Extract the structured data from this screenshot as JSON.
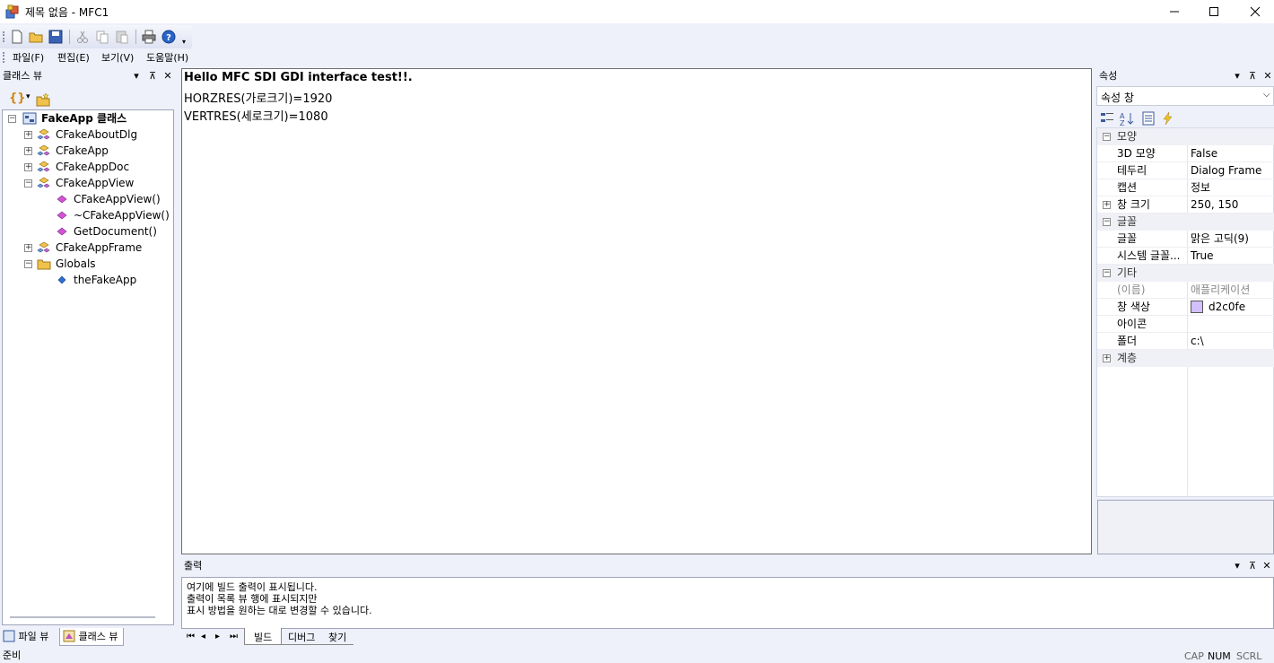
{
  "window": {
    "title": "제목 없음 - MFC1"
  },
  "menu": [
    "파일(F)",
    "편집(E)",
    "보기(V)",
    "도움말(H)"
  ],
  "classview": {
    "header": "클래스 뷰",
    "root": "FakeApp 클래스",
    "items": [
      {
        "label": "CFakeAboutDlg",
        "icon": "class-icon"
      },
      {
        "label": "CFakeApp",
        "icon": "class-icon"
      },
      {
        "label": "CFakeAppDoc",
        "icon": "class-icon"
      },
      {
        "label": "CFakeAppView",
        "icon": "class-icon"
      },
      {
        "label": "CFakeAppView()",
        "icon": "method-icon"
      },
      {
        "label": "~CFakeAppView()",
        "icon": "method-icon"
      },
      {
        "label": "GetDocument()",
        "icon": "method-icon"
      },
      {
        "label": "CFakeAppFrame",
        "icon": "class-icon"
      },
      {
        "label": "Globals",
        "icon": "folder-icon"
      },
      {
        "label": "theFakeApp",
        "icon": "variable-icon"
      }
    ],
    "tabs": [
      "파일 뷰",
      "클래스 뷰"
    ]
  },
  "document": {
    "lines": [
      "Hello MFC SDI GDI interface test!!.",
      "HORZRES(가로크기)=1920",
      "VERTRES(세로크기)=1080"
    ]
  },
  "properties": {
    "header": "속성",
    "combo": "속성 창",
    "rows": [
      {
        "type": "cat",
        "name": "모양",
        "exp": "⊟"
      },
      {
        "type": "prop",
        "name": "3D 모양",
        "value": "False"
      },
      {
        "type": "prop",
        "name": "테두리",
        "value": "Dialog Frame"
      },
      {
        "type": "prop",
        "name": "캡션",
        "value": "정보"
      },
      {
        "type": "prop",
        "name": "창 크기",
        "value": "250, 150",
        "exp": "⊞"
      },
      {
        "type": "cat",
        "name": "글꼴",
        "exp": "⊟"
      },
      {
        "type": "prop",
        "name": "글꼴",
        "value": "맑은 고딕(9)"
      },
      {
        "type": "prop",
        "name": "시스템 글꼴...",
        "value": "True"
      },
      {
        "type": "cat",
        "name": "기타",
        "exp": "⊟"
      },
      {
        "type": "prop",
        "name": "(이름)",
        "value": "애플리케이션",
        "disabled": true
      },
      {
        "type": "prop",
        "name": "창 색상",
        "value": "d2c0fe",
        "swatch": "#d2c0fe"
      },
      {
        "type": "prop",
        "name": "아이콘",
        "value": ""
      },
      {
        "type": "prop",
        "name": "폴더",
        "value": "c:\\"
      },
      {
        "type": "cat",
        "name": "계층",
        "exp": "⊞"
      }
    ]
  },
  "output": {
    "header": "출력",
    "lines": [
      "여기에 빌드 출력이 표시됩니다.",
      "출력이 목록 뷰 행에 표시되지만",
      "표시 방법을 원하는 대로 변경할 수 있습니다."
    ],
    "tabs": [
      "빌드",
      "디버그",
      "찾기"
    ]
  },
  "status": {
    "text": "준비",
    "indicators": [
      "CAP",
      "NUM",
      "SCRL"
    ]
  }
}
